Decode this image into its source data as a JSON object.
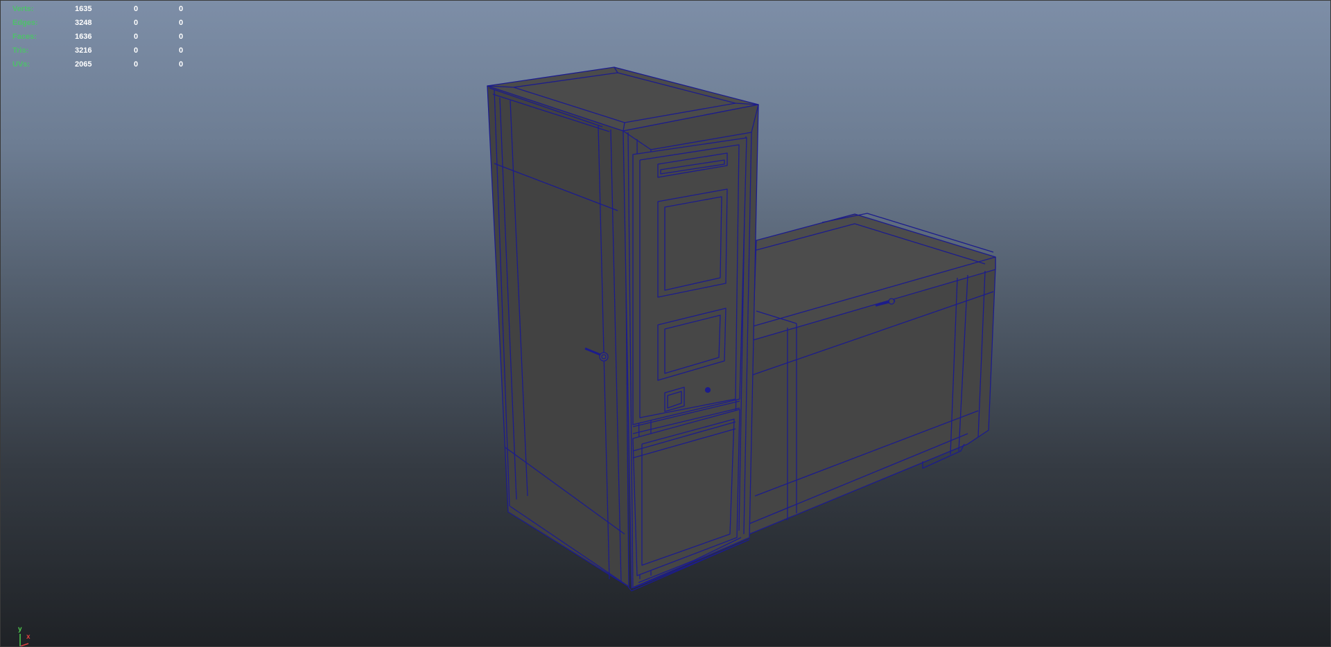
{
  "viewport": {
    "name": "3D viewport"
  },
  "hud": {
    "rows": [
      {
        "label": "Verts:",
        "v1": "1635",
        "v2": "0",
        "v3": "0"
      },
      {
        "label": "Edges:",
        "v1": "3248",
        "v2": "0",
        "v3": "0"
      },
      {
        "label": "Faces:",
        "v1": "1636",
        "v2": "0",
        "v3": "0"
      },
      {
        "label": "Tris:",
        "v1": "3216",
        "v2": "0",
        "v3": "0"
      },
      {
        "label": "UVs:",
        "v1": "2065",
        "v2": "0",
        "v3": "0"
      }
    ]
  },
  "axis": {
    "y_label": "y",
    "x_label": "x",
    "colors": {
      "y": "#4fd04f",
      "x": "#e04040"
    }
  },
  "colors": {
    "wire": "#1c1c8c",
    "face": "#474747",
    "face_dark": "#3e3e3e",
    "face_top": "#4c4c4c"
  }
}
